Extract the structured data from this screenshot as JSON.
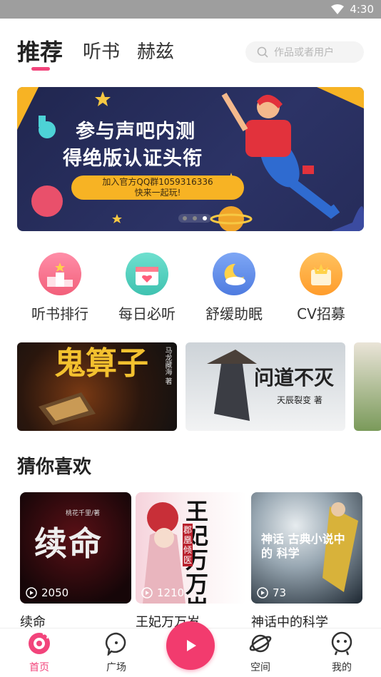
{
  "status_bar": {
    "time": "4:30"
  },
  "top_tabs": [
    {
      "label": "推荐",
      "active": true
    },
    {
      "label": "听书",
      "active": false
    },
    {
      "label": "赫兹",
      "active": false
    }
  ],
  "search": {
    "placeholder": "作品或者用户"
  },
  "banner": {
    "line1": "参与声吧内测",
    "line2": "得绝版认证头衔",
    "pill_line1": "加入官方QQ群1059316336",
    "pill_line2": "快来一起玩!"
  },
  "quick_links": [
    {
      "label": "听书排行",
      "icon": "podium-icon"
    },
    {
      "label": "每日必听",
      "icon": "calendar-heart-icon"
    },
    {
      "label": "舒缓助眠",
      "icon": "moon-cloud-icon"
    },
    {
      "label": "CV招募",
      "icon": "crown-icon"
    }
  ],
  "featured_covers": [
    {
      "title": "鬼算子",
      "author": "马龙藏海 著"
    },
    {
      "title": "问道不灭",
      "author": "天辰裂变 著"
    }
  ],
  "section_title": "猜你喜欢",
  "recommend_cards": [
    {
      "name": "续命",
      "plays": "2050",
      "cover_text": "续命",
      "cover_author": "桃花千里/著"
    },
    {
      "name": "王妃万万岁",
      "plays": "1210",
      "cover_text": "王妃万万岁",
      "cover_sub": "郡凰倾医"
    },
    {
      "name": "神话中的科学",
      "plays": "73",
      "cover_text": "神话 古典小说中的 科学"
    }
  ],
  "bottom_nav": [
    {
      "label": "首页",
      "icon": "home-icon",
      "active": true
    },
    {
      "label": "广场",
      "icon": "chat-bubble-icon",
      "active": false
    },
    {
      "label": "空间",
      "icon": "planet-icon",
      "active": false
    },
    {
      "label": "我的",
      "icon": "profile-face-icon",
      "active": false
    }
  ],
  "colors": {
    "accent": "#f2447b",
    "banner_bg": "#232a57",
    "pill": "#f7b324"
  }
}
